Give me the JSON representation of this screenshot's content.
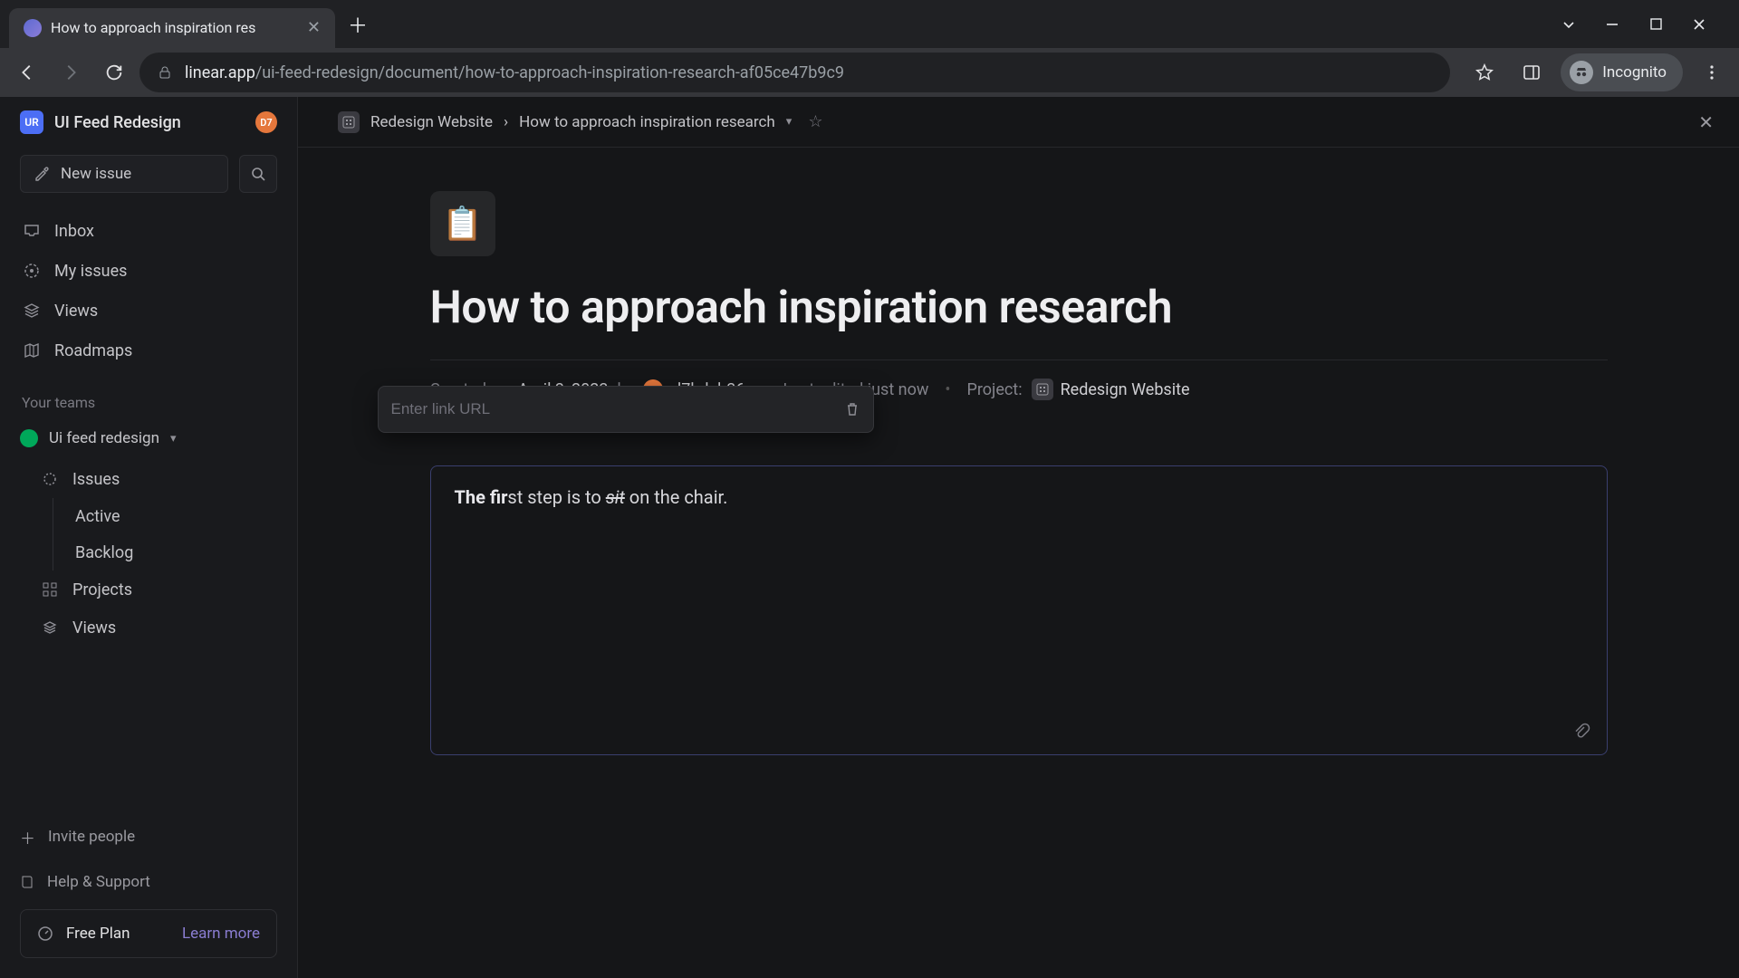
{
  "browser": {
    "tab_title": "How to approach inspiration res",
    "url_domain": "linear.app",
    "url_path": "/ui-feed-redesign/document/how-to-approach-inspiration-research-af05ce47b9c9",
    "incognito_label": "Incognito"
  },
  "workspace": {
    "badge": "UR",
    "name": "UI Feed Redesign",
    "user_badge": "D7",
    "new_issue_label": "New issue"
  },
  "sidebar": {
    "items": [
      {
        "icon": "inbox-icon",
        "label": "Inbox"
      },
      {
        "icon": "target-icon",
        "label": "My issues"
      },
      {
        "icon": "layers-icon",
        "label": "Views"
      },
      {
        "icon": "map-icon",
        "label": "Roadmaps"
      }
    ],
    "teams_label": "Your teams",
    "team": {
      "name": "Ui feed redesign",
      "groups": [
        {
          "icon": "circle-dashed-icon",
          "label": "Issues",
          "children": [
            "Active",
            "Backlog"
          ]
        },
        {
          "icon": "grid-icon",
          "label": "Projects",
          "children": []
        },
        {
          "icon": "layers-icon",
          "label": "Views",
          "children": []
        }
      ]
    },
    "invite_label": "Invite people",
    "help_label": "Help & Support",
    "plan_label": "Free Plan",
    "learn_more_label": "Learn more"
  },
  "breadcrumb": {
    "project": "Redesign Website",
    "sep": "›",
    "doc": "How to approach inspiration research"
  },
  "document": {
    "emoji": "📋",
    "title": "How to approach inspiration research",
    "created_prefix": "Created on",
    "created_date": "April 3, 2023",
    "created_by_label": "by",
    "author_badge": "D7",
    "author": "d7bdeb36",
    "edited_label": "Last edited just now",
    "project_label": "Project:",
    "project_name": "Redesign Website",
    "link_popover_placeholder": "Enter link URL",
    "body": {
      "bold_part": "The fir",
      "mid_part": "st step is to ",
      "strike_part": "sit",
      "tail_part": " on the chair."
    }
  }
}
